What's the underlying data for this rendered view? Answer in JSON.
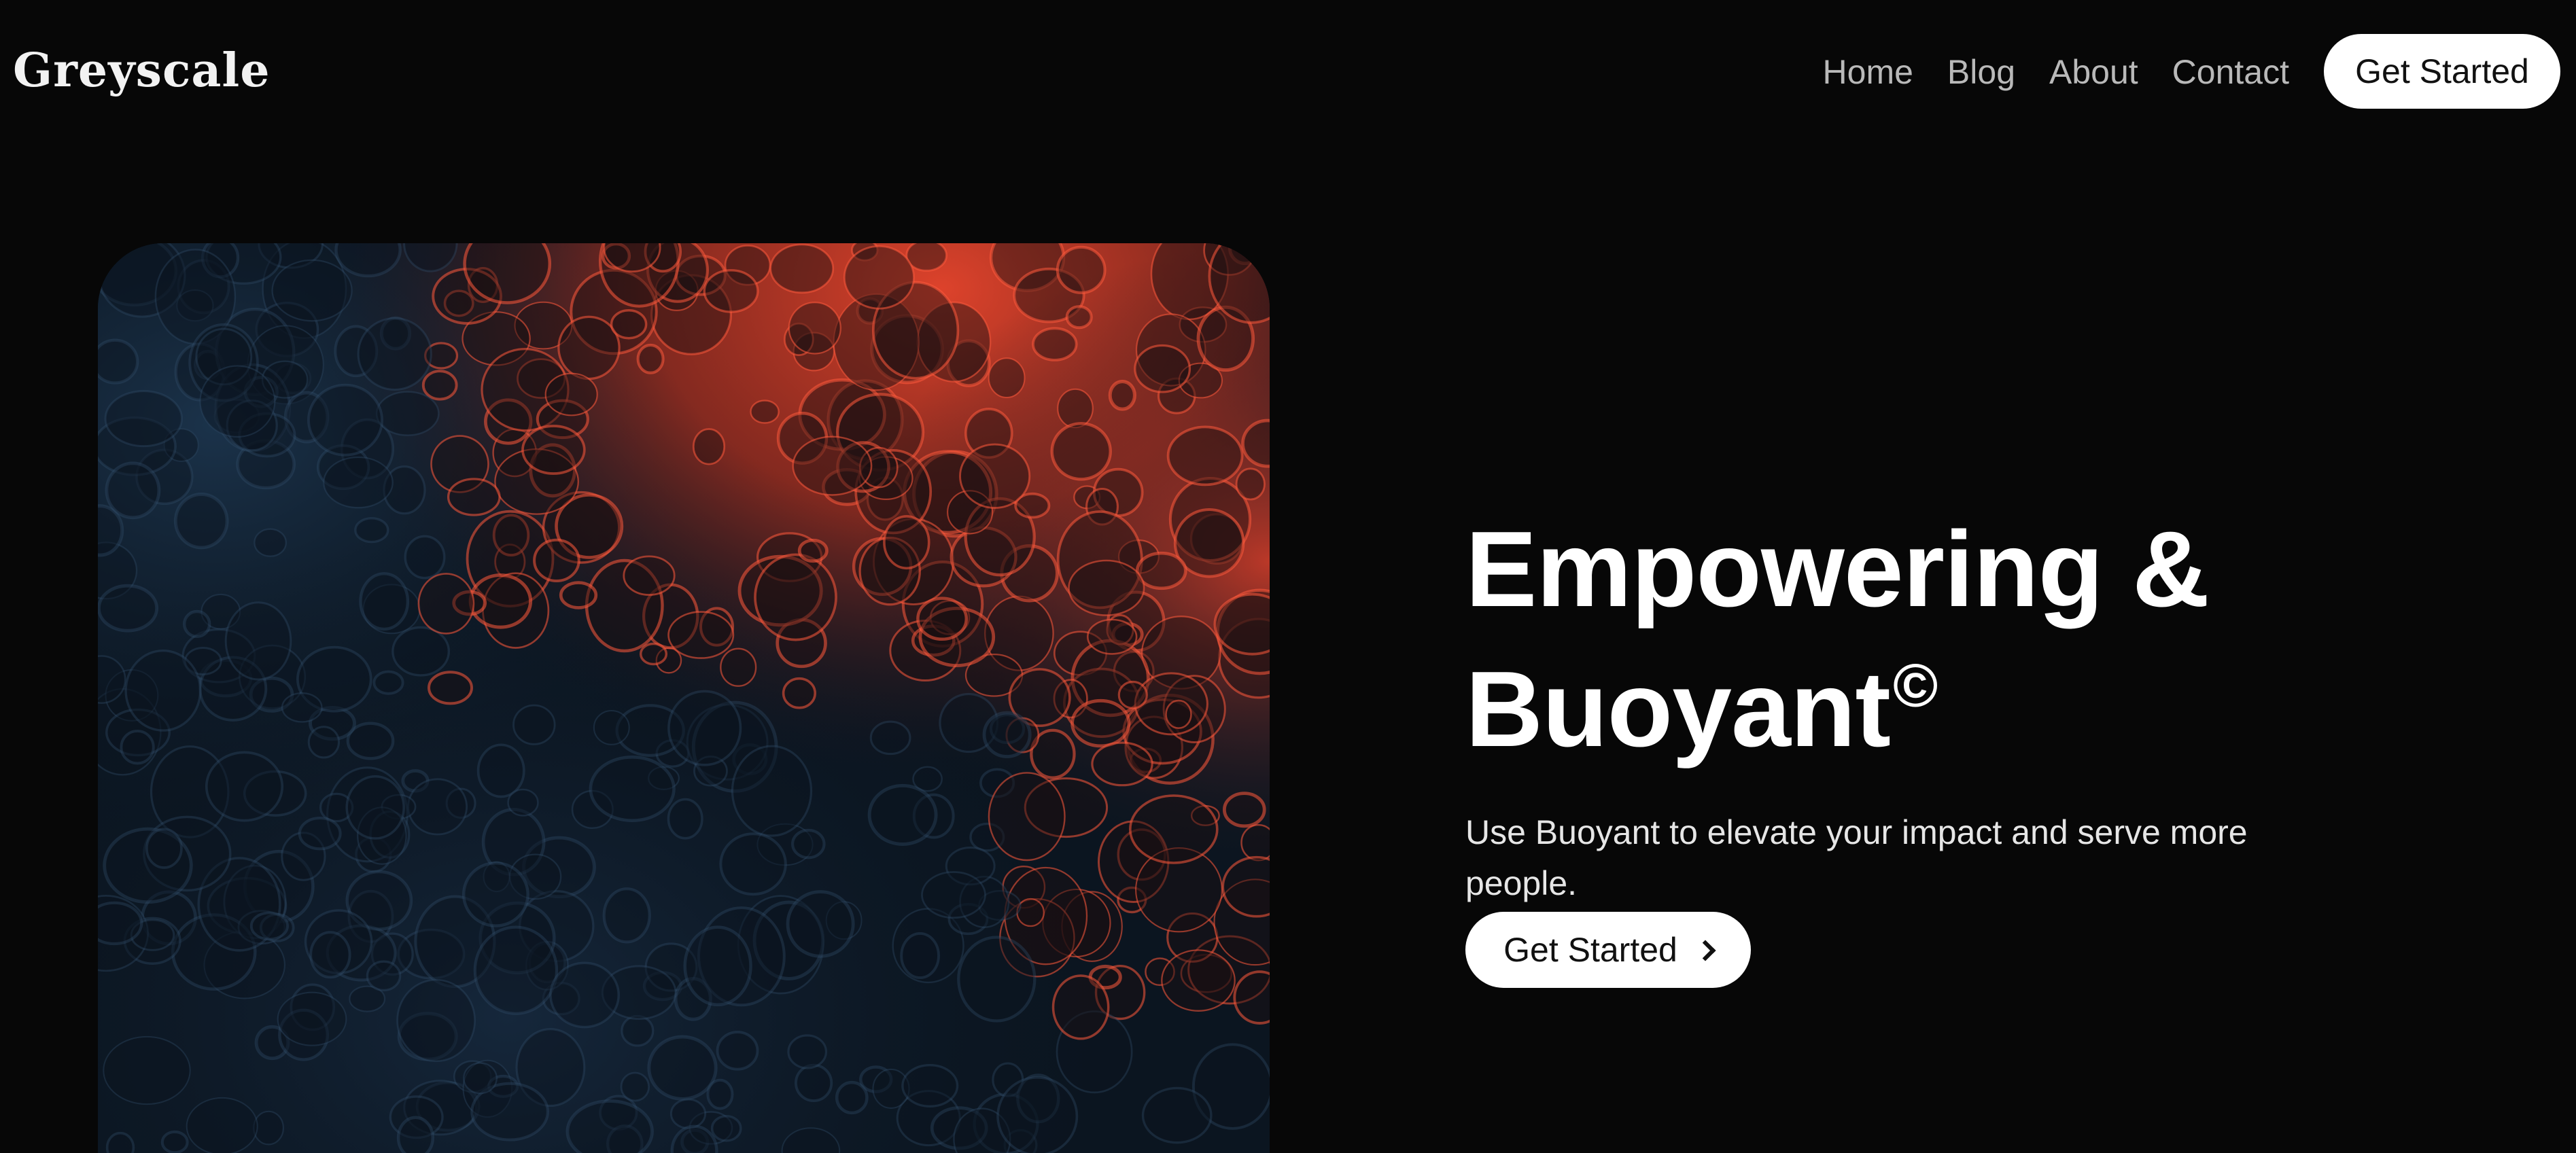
{
  "header": {
    "logo": "Greyscale",
    "nav": [
      {
        "label": "Home"
      },
      {
        "label": "Blog"
      },
      {
        "label": "About"
      },
      {
        "label": "Contact"
      }
    ],
    "cta_label": "Get Started"
  },
  "hero": {
    "title_line1": "Empowering &",
    "title_line2": "Buoyant",
    "title_mark": "©",
    "subtitle": "Use Buoyant to elevate your impact and serve more people.",
    "cta_label": "Get Started",
    "cta_icon": "chevron-right-icon",
    "image": "abstract-fluid-art-image"
  },
  "colors": {
    "background": "#070707",
    "text": "#ffffff",
    "nav_text": "#b9b9b9",
    "button_bg": "#ffffff",
    "button_text": "#111111",
    "image_accent": "#e8452c",
    "image_base": "#0b1520"
  }
}
